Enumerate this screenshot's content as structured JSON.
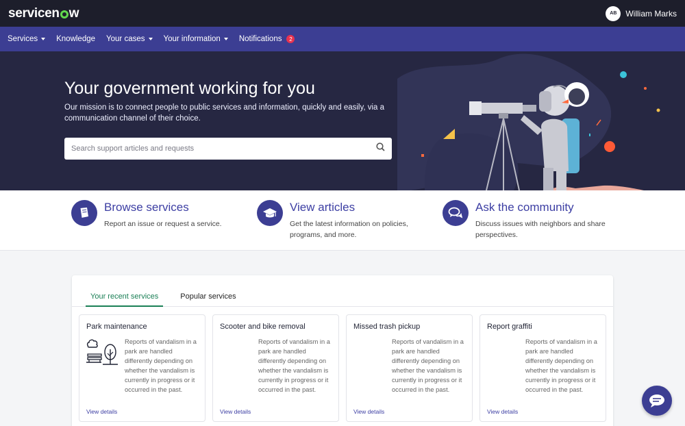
{
  "header": {
    "logo_text": "servicenow",
    "user": {
      "initials": "AB",
      "name": "William Marks"
    }
  },
  "nav": {
    "items": [
      {
        "label": "Services",
        "dropdown": true
      },
      {
        "label": "Knowledge",
        "dropdown": false
      },
      {
        "label": "Your cases",
        "dropdown": true
      },
      {
        "label": "Your information",
        "dropdown": true
      },
      {
        "label": "Notifications",
        "badge": "2"
      }
    ]
  },
  "hero": {
    "title": "Your government working for you",
    "subtitle": "Our mission is to connect people to public services and information, quickly and easily, via a communication channel of their choice.",
    "search_placeholder": "Search support articles and requests"
  },
  "features": [
    {
      "title": "Browse services",
      "desc": "Report an issue or request a service.",
      "icon": "book-icon"
    },
    {
      "title": "View articles",
      "desc": "Get the latest information on policies, programs, and more.",
      "icon": "graduation-cap-icon"
    },
    {
      "title": "Ask the community",
      "desc": "Discuss issues with neighbors and share perspectives.",
      "icon": "chat-bubbles-icon"
    }
  ],
  "services": {
    "tabs": [
      {
        "label": "Your recent services",
        "active": true
      },
      {
        "label": "Popular services",
        "active": false
      }
    ],
    "cards": [
      {
        "title": "Park maintenance",
        "desc": "Reports of vandalism in a park are handled differently depending on whether the vandalism is currently in progress or it occurred in the past.",
        "link": "View details",
        "icon": "park-icon"
      },
      {
        "title": "Scooter and bike removal",
        "desc": "Reports of vandalism in a park are handled differently depending on whether the vandalism is currently in progress or it occurred in the past.",
        "link": "View details"
      },
      {
        "title": "Missed trash pickup",
        "desc": "Reports of vandalism in a park are handled differently depending on whether the vandalism is currently in progress or it occurred in the past.",
        "link": "View details"
      },
      {
        "title": "Report graffiti",
        "desc": "Reports of vandalism in a park are handled differently depending on whether the vandalism is currently in progress or it occurred in the past.",
        "link": "View details"
      }
    ]
  },
  "colors": {
    "topbar": "#1d1e2b",
    "navbar": "#3c3e93",
    "hero": "#262742",
    "accent_green": "#1a7f55",
    "badge": "#e8324f",
    "logo_green": "#62d84e"
  }
}
